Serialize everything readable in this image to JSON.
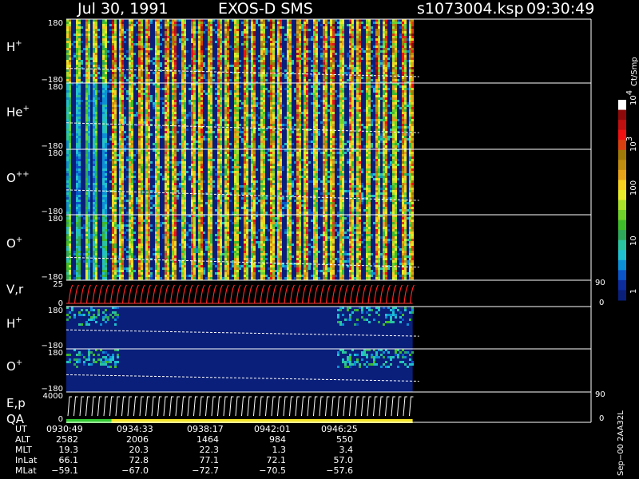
{
  "header": {
    "date": "Jul 30, 1991",
    "instrument": "EXOS-D SMS",
    "file": "s1073004.ksp",
    "start_time": "09:30:49"
  },
  "colors": {
    "background": "#000000",
    "panel_background": "#0a1f7a",
    "pitch_curve": "#ffffff",
    "v_traces": "#ff2222",
    "qa_good": "#33cc33",
    "qa_ok": "#f5e629"
  },
  "colorbar": {
    "unit": "Ct/Smp",
    "tick_labels": [
      "1",
      "10",
      "100",
      "10",
      "10"
    ],
    "tick_exponents": [
      "",
      "",
      "",
      "3",
      "4"
    ],
    "colors": [
      "#0a1f7a",
      "#0d2c9e",
      "#0b55c8",
      "#0d8fd6",
      "#20c0d0",
      "#2ac4a0",
      "#2fa85a",
      "#3fbc2a",
      "#6fd22a",
      "#a8e02a",
      "#e6ec2a",
      "#f5d021",
      "#e6a218",
      "#c08c10",
      "#a07a08",
      "#d84010",
      "#f01212",
      "#c01010",
      "#8e0a0a",
      "#ffffff"
    ]
  },
  "chart_data": {
    "type": "heatmap",
    "title": "Jul 30, 1991   EXOS-D SMS",
    "x_time_labels": [
      "0930:49",
      "0934:33",
      "0938:17",
      "0942:01",
      "0946:25"
    ],
    "data_extent_fraction": 0.66,
    "panels": [
      {
        "label": "H",
        "sup": "+",
        "ylim": [
          -180,
          180
        ],
        "ticks": [
          "180",
          "−180"
        ],
        "type": "spin_heatmap",
        "level_before": 0.55,
        "level_after": 0.72,
        "pitch_start": 0.77,
        "pitch_end": 0.9
      },
      {
        "label": "He",
        "sup": "+",
        "ylim": [
          -180,
          180
        ],
        "ticks": [
          "180",
          "−180"
        ],
        "type": "spin_heatmap",
        "level_before": 0.25,
        "level_after": 0.62,
        "pitch_start": 0.6,
        "pitch_end": 0.75
      },
      {
        "label": "O",
        "sup": "++",
        "ylim": [
          -180,
          180
        ],
        "ticks": [
          "180",
          "−180"
        ],
        "type": "spin_heatmap",
        "level_before": 0.2,
        "level_after": 0.6,
        "pitch_start": 0.62,
        "pitch_end": 0.78
      },
      {
        "label": "O",
        "sup": "+",
        "ylim": [
          -180,
          180
        ],
        "ticks": [
          "180",
          "−180"
        ],
        "type": "spin_heatmap",
        "level_before": 0.35,
        "level_after": 0.62,
        "pitch_start": 0.65,
        "pitch_end": 0.8
      },
      {
        "label": "V,r",
        "sup": "",
        "ylim": [
          0,
          25
        ],
        "ticks": [
          "25",
          "0"
        ],
        "right_ticks": [
          "90",
          "0"
        ],
        "type": "traces"
      },
      {
        "label": "H",
        "sup": "+",
        "ylim": [
          -180,
          180
        ],
        "ticks": [
          "180",
          "−180"
        ],
        "type": "sparse_heatmap",
        "pitch_start": 0.55,
        "pitch_end": 0.7
      },
      {
        "label": "O",
        "sup": "+",
        "ylim": [
          -180,
          180
        ],
        "ticks": [
          "180",
          "−180"
        ],
        "type": "sparse_heatmap",
        "pitch_start": 0.6,
        "pitch_end": 0.75
      },
      {
        "label": "E,p",
        "sub_label": "QA",
        "sup": "",
        "ylim": [
          0,
          4000
        ],
        "ticks": [
          "4000",
          "0"
        ],
        "right_ticks": [
          "90",
          "0"
        ],
        "type": "energy_qa"
      }
    ],
    "orbit_table": {
      "rows": [
        {
          "name": "UT",
          "values": [
            "0930:49",
            "0934:33",
            "0938:17",
            "0942:01",
            "0946:25"
          ]
        },
        {
          "name": "ALT",
          "values": [
            "2582",
            "2006",
            "1464",
            "984",
            "550"
          ]
        },
        {
          "name": "MLT",
          "values": [
            "19.3",
            "20.3",
            "22.3",
            "1.3",
            "3.4"
          ]
        },
        {
          "name": "InLat",
          "values": [
            "66.1",
            "72.8",
            "77.1",
            "72.1",
            "57.0"
          ]
        },
        {
          "name": "MLat",
          "values": [
            "−59.1",
            "−67.0",
            "−72.7",
            "−70.5",
            "−57.6"
          ]
        }
      ]
    },
    "footer_label": "Sep−00  2AA32L"
  }
}
